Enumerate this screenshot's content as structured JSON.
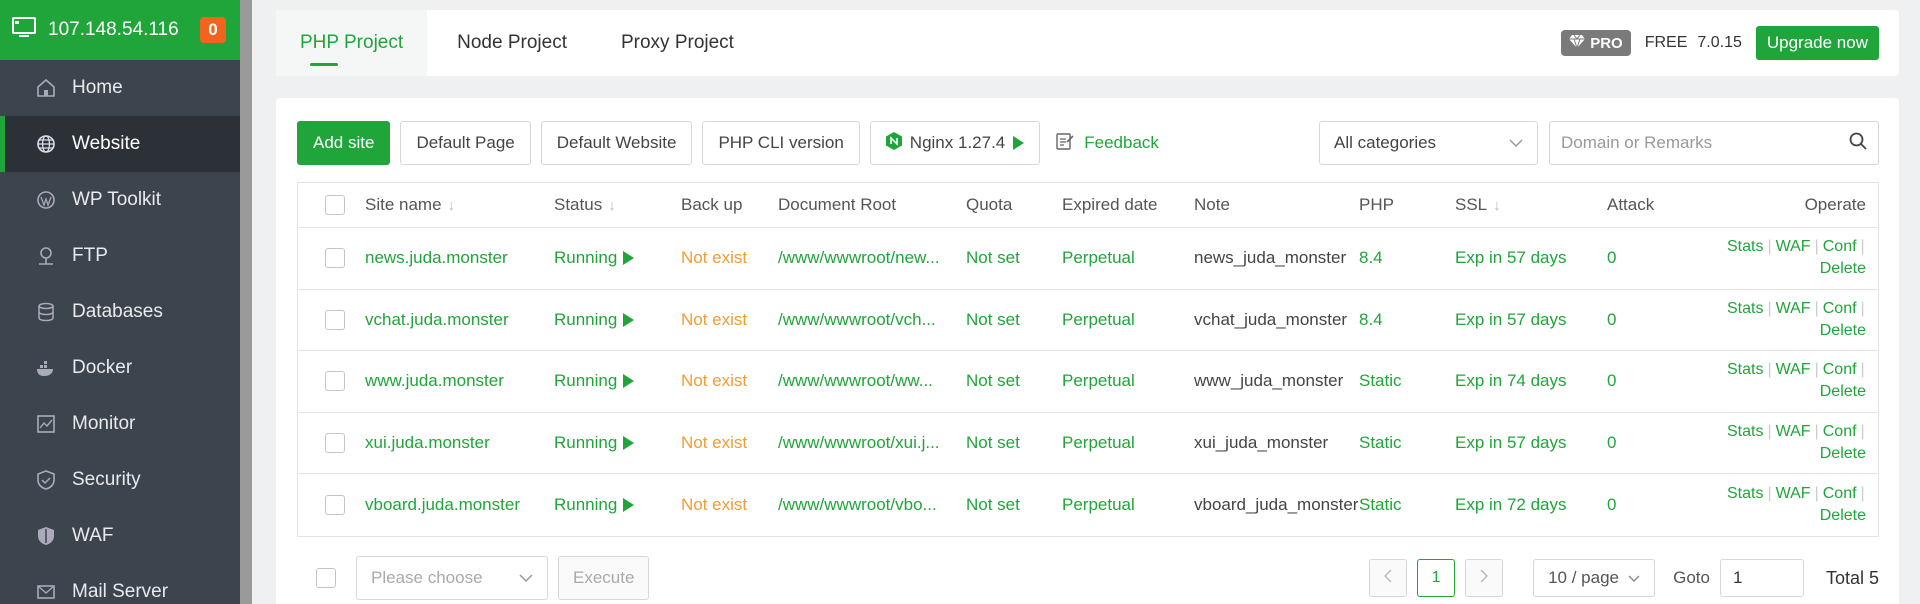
{
  "server": {
    "ip": "107.148.54.116",
    "badge": "0"
  },
  "sidebar": {
    "items": [
      {
        "label": "Home",
        "icon": "home-icon"
      },
      {
        "label": "Website",
        "icon": "globe-icon"
      },
      {
        "label": "WP Toolkit",
        "icon": "wordpress-icon"
      },
      {
        "label": "FTP",
        "icon": "ftp-icon"
      },
      {
        "label": "Databases",
        "icon": "database-icon"
      },
      {
        "label": "Docker",
        "icon": "docker-icon"
      },
      {
        "label": "Monitor",
        "icon": "monitor-icon"
      },
      {
        "label": "Security",
        "icon": "shield-icon"
      },
      {
        "label": "WAF",
        "icon": "waf-icon"
      },
      {
        "label": "Mail Server",
        "icon": "mail-icon"
      }
    ],
    "active": "Website"
  },
  "tabs": [
    {
      "label": "PHP Project",
      "active": true
    },
    {
      "label": "Node Project"
    },
    {
      "label": "Proxy Project"
    }
  ],
  "header_right": {
    "pro_label": "PRO",
    "free_label": "FREE",
    "version": "7.0.15",
    "upgrade_label": "Upgrade now"
  },
  "toolbar": {
    "add_site": "Add site",
    "default_page": "Default Page",
    "default_website": "Default Website",
    "php_cli": "PHP CLI version",
    "nginx": "Nginx 1.27.4",
    "feedback": "Feedback",
    "category": "All categories",
    "search_placeholder": "Domain or Remarks"
  },
  "table": {
    "headers": {
      "site_name": "Site name",
      "status": "Status",
      "backup": "Back up",
      "root": "Document Root",
      "quota": "Quota",
      "expired": "Expired date",
      "note": "Note",
      "php": "PHP",
      "ssl": "SSL",
      "attack": "Attack",
      "operate": "Operate"
    },
    "rows": [
      {
        "name": "news.juda.monster",
        "status": "Running",
        "backup": "Not exist",
        "root": "/www/wwwroot/new...",
        "quota": "Not set",
        "expired": "Perpetual",
        "note": "news_juda_monster",
        "php": "8.4",
        "ssl": "Exp in 57 days",
        "attack": "0"
      },
      {
        "name": "vchat.juda.monster",
        "status": "Running",
        "backup": "Not exist",
        "root": "/www/wwwroot/vch...",
        "quota": "Not set",
        "expired": "Perpetual",
        "note": "vchat_juda_monster",
        "php": "8.4",
        "ssl": "Exp in 57 days",
        "attack": "0"
      },
      {
        "name": "www.juda.monster",
        "status": "Running",
        "backup": "Not exist",
        "root": "/www/wwwroot/ww...",
        "quota": "Not set",
        "expired": "Perpetual",
        "note": "www_juda_monster",
        "php": "Static",
        "ssl": "Exp in 74 days",
        "attack": "0"
      },
      {
        "name": "xui.juda.monster",
        "status": "Running",
        "backup": "Not exist",
        "root": "/www/wwwroot/xui.j...",
        "quota": "Not set",
        "expired": "Perpetual",
        "note": "xui_juda_monster",
        "php": "Static",
        "ssl": "Exp in 57 days",
        "attack": "0"
      },
      {
        "name": "vboard.juda.monster",
        "status": "Running",
        "backup": "Not exist",
        "root": "/www/wwwroot/vbo...",
        "quota": "Not set",
        "expired": "Perpetual",
        "note": "vboard_juda_monster",
        "php": "Static",
        "ssl": "Exp in 72 days",
        "attack": "0"
      }
    ],
    "ops": {
      "stats": "Stats",
      "waf": "WAF",
      "conf": "Conf",
      "delete": "Delete"
    }
  },
  "bottom": {
    "batch_placeholder": "Please choose",
    "execute": "Execute",
    "current_page": "1",
    "page_size": "10 / page",
    "goto_label": "Goto",
    "goto_value": "1",
    "total": "Total 5"
  },
  "colors": {
    "brand": "#20a53a",
    "sidebar": "#3c444d",
    "warning": "#f39c34",
    "badge": "#f0641e"
  }
}
